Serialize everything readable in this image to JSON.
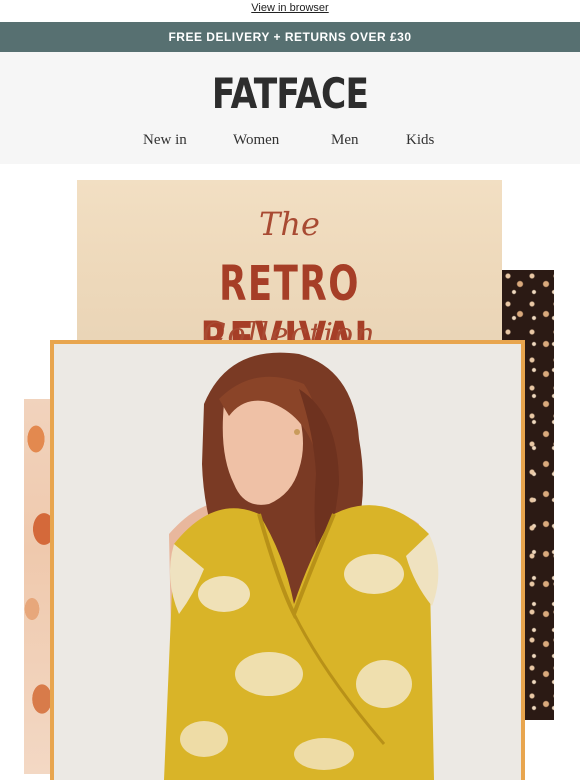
{
  "topbar": {
    "view_in_browser": "View in browser"
  },
  "promo": {
    "text": "FREE DELIVERY + RETURNS OVER £30"
  },
  "header": {
    "logo": "FATFACE",
    "nav": [
      "New in",
      "Women",
      "Men",
      "Kids"
    ]
  },
  "hero": {
    "title_the": "The",
    "title_main": "RETRO REVIVAL",
    "title_collection": "Collection"
  },
  "colors": {
    "promo_bar": "#577071",
    "title_accent": "#a63e27",
    "frame": "#e8a54e",
    "title_panel": "#f0dcbf"
  }
}
